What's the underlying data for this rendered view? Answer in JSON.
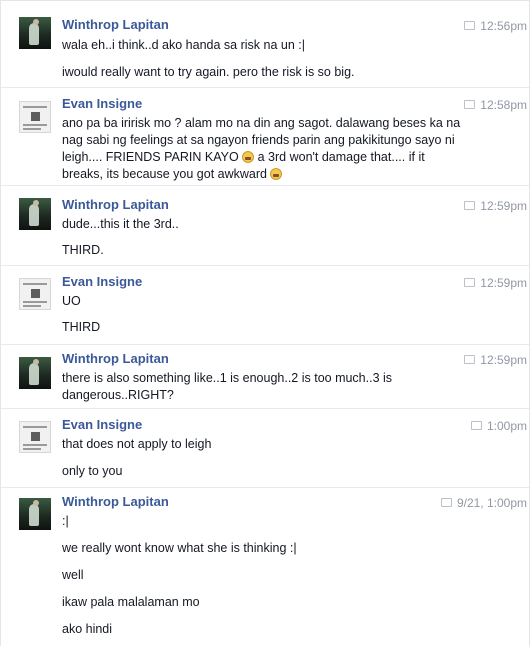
{
  "messages": [
    {
      "sender": "Winthrop Lapitan",
      "time": "12:56pm",
      "lines": [
        "wala eh..i think..d ako handa sa risk na un :|",
        "iwould really want to try again. pero the risk is so big."
      ]
    },
    {
      "sender": "Evan Insigne",
      "time": "12:58pm",
      "p1": "ano pa ba iririsk mo ? alam mo na din ang sagot. dalawang beses ka na",
      "p2": "nag sabi ng feelings at sa ngayon friends parin ang pakikitungo sayo ni",
      "p3a": "leigh.... FRIENDS PARIN KAYO",
      "p3b": " a 3rd won't damage that.... if it",
      "p4a": "breaks, its because you got awkward",
      "emoji": "grimace-emoji"
    },
    {
      "sender": "Winthrop Lapitan",
      "time": "12:59pm",
      "lines": [
        "dude...this it the 3rd..",
        "THIRD."
      ]
    },
    {
      "sender": "Evan Insigne",
      "time": "12:59pm",
      "lines": [
        "UO",
        "THIRD"
      ]
    },
    {
      "sender": "Winthrop Lapitan",
      "time": "12:59pm",
      "lines": [
        "there is also something like..1 is enough..2 is too much..3 is",
        "dangerous..RIGHT?"
      ]
    },
    {
      "sender": "Evan Insigne",
      "time": "1:00pm",
      "lines": [
        "that does not apply to leigh",
        "only to you"
      ]
    },
    {
      "sender": "Winthrop Lapitan",
      "time": "9/21, 1:00pm",
      "lines": [
        ":|",
        "we really wont know what she is thinking :|",
        "well",
        "ikaw pala malalaman mo",
        "ako hindi"
      ]
    }
  ],
  "colors": {
    "name": "#3b5998",
    "time": "#9197a3",
    "text": "#141823",
    "divider": "#e9eaed"
  }
}
